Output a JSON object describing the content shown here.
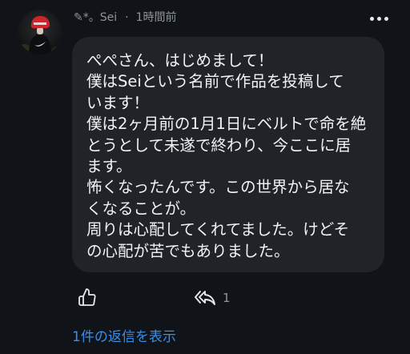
{
  "colors": {
    "background": "#101318",
    "bubble": "#202327",
    "text": "#f1f3f5",
    "muted": "#8f949b",
    "link": "#3d8ee6",
    "icon": "#e7e9ea"
  },
  "comment": {
    "avatar_icon": "user-avatar",
    "author": "✎*。Sei",
    "separator": "·",
    "time": "1時間前",
    "more_icon": "more-horizontal-icon",
    "body_lines": [
      "ぺぺさん、はじめまして！",
      "僕はSeiという名前で作品を投稿して",
      "います！",
      "僕は2ヶ月前の1月1日にベルトで命を絶",
      "とうとして未遂で終わり、今ここに居",
      "ます。",
      "怖くなったんです。この世界から居な",
      "くなることが。",
      "周りは心配してくれてました。けどそ",
      "の心配が苦でもありました。"
    ],
    "actions": {
      "like_icon": "thumbs-up-icon",
      "reply_icon": "reply-all-icon",
      "reply_count": "1"
    },
    "view_replies": "1件の返信を表示"
  }
}
